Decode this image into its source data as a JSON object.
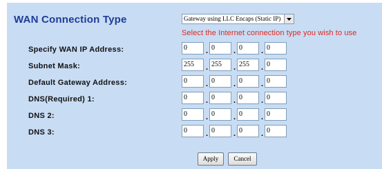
{
  "section_title": "WAN Connection Type",
  "connection_type": {
    "selected": "Gateway using LLC Encaps (Static IP)",
    "hint": "Select the Internet connection type you wish to use"
  },
  "fields": [
    {
      "label": "Specify WAN IP Address:",
      "octets": [
        "0",
        "0",
        "0",
        "0"
      ]
    },
    {
      "label": "Subnet Mask:",
      "octets": [
        "255",
        "255",
        "255",
        "0"
      ]
    },
    {
      "label": "Default Gateway Address:",
      "octets": [
        "0",
        "0",
        "0",
        "0"
      ]
    },
    {
      "label": "DNS(Required)  1:",
      "octets": [
        "0",
        "0",
        "0",
        "0"
      ]
    },
    {
      "label": "DNS   2:",
      "octets": [
        "0",
        "0",
        "0",
        "0"
      ]
    },
    {
      "label": "DNS   3:",
      "octets": [
        "0",
        "0",
        "0",
        "0"
      ]
    }
  ],
  "buttons": {
    "apply": "Apply",
    "cancel": "Cancel"
  },
  "colors": {
    "panel": "#c8dcf4",
    "title": "#1f3c96",
    "hint": "#e0281e"
  }
}
